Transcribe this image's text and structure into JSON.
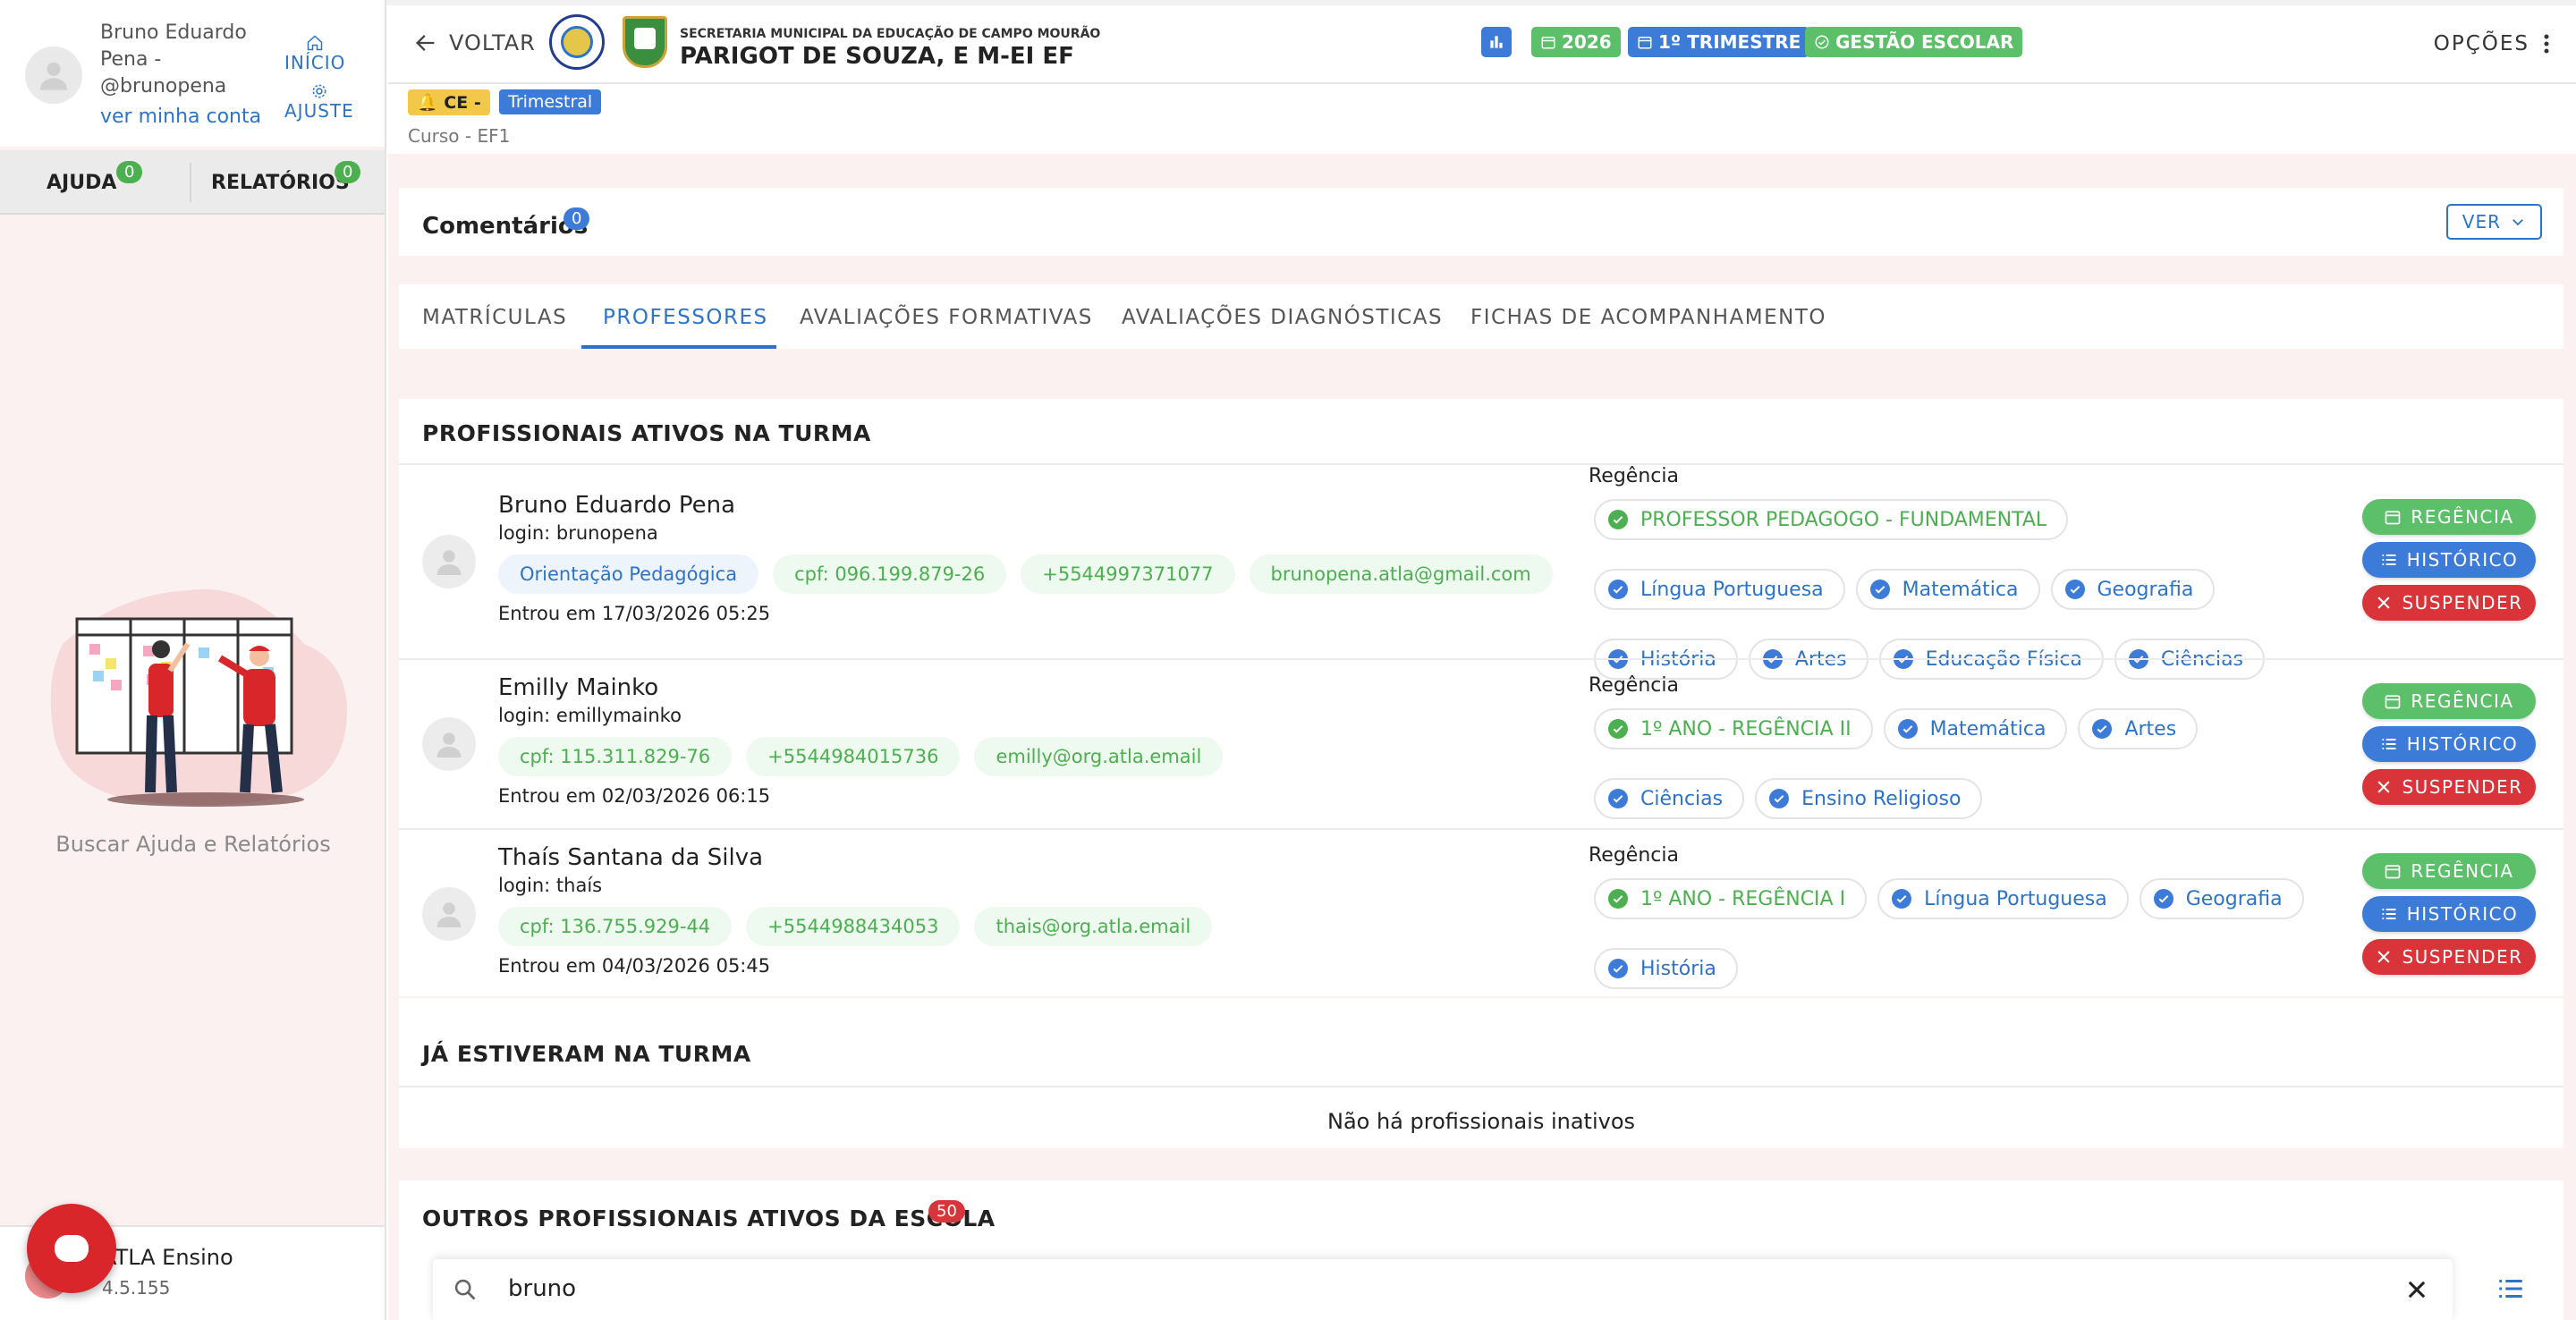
{
  "sidebar": {
    "user_name": "Bruno Eduardo Pena - @brunopena",
    "account_link": "ver minha conta",
    "nav_inicio": "INÍCIO",
    "nav_ajuste": "AJUSTE",
    "tab_ajuda": "AJUDA",
    "tab_ajuda_count": "0",
    "tab_relatorios": "RELATÓRIOS",
    "tab_relatorios_count": "0",
    "help_search": "Buscar Ajuda e Relatórios",
    "app_name": "ATLA Ensino",
    "app_version": "4.5.155"
  },
  "header": {
    "back": "VOLTAR",
    "secretaria": "SECRETARIA MUNICIPAL DA EDUCAÇÃO DE CAMPO MOURÃO",
    "school": "PARIGOT DE SOUZA, E M-EI EF",
    "chip_year": "2026",
    "chip_period": "1º TRIMESTRE",
    "chip_mode": "GESTÃO ESCOLAR",
    "options": "OPÇÕES"
  },
  "strip": {
    "tag_ce": "CE -",
    "tag_period": "Trimestral",
    "curso": "Curso - EF1"
  },
  "comments": {
    "title": "Comentários",
    "count": "0",
    "ver": "VER"
  },
  "tabs": [
    {
      "label": "MATRÍCULAS"
    },
    {
      "label": "PROFESSORES"
    },
    {
      "label": "AVALIAÇÕES FORMATIVAS"
    },
    {
      "label": "AVALIAÇÕES DIAGNÓSTICAS"
    },
    {
      "label": "FICHAS DE ACOMPANHAMENTO"
    }
  ],
  "active_section": {
    "title": "PROFISSIONAIS ATIVOS NA TURMA",
    "regencia_label": "Regência",
    "btn_regencia": "REGÊNCIA",
    "btn_historico": "HISTÓRICO",
    "btn_suspender": "SUSPENDER",
    "professionals": [
      {
        "name": "Bruno Eduardo Pena",
        "login": "login: brunopena",
        "role": "Orientação Pedagógica",
        "cpf": "cpf: 096.199.879-26",
        "phone": "+5544997371077",
        "email": "brunopena.atla@gmail.com",
        "entered": "Entrou em 17/03/2026 05:25",
        "regencias": [
          {
            "label": "PROFESSOR PEDAGOGO - FUNDAMENTAL",
            "kind": "g"
          },
          {
            "label": "Língua Portuguesa",
            "kind": "b"
          },
          {
            "label": "Matemática",
            "kind": "b"
          },
          {
            "label": "Geografia",
            "kind": "b"
          },
          {
            "label": "História",
            "kind": "b"
          },
          {
            "label": "Artes",
            "kind": "b"
          },
          {
            "label": "Educação Física",
            "kind": "b"
          },
          {
            "label": "Ciências",
            "kind": "b"
          }
        ]
      },
      {
        "name": "Emilly Mainko",
        "login": "login: emillymainko",
        "cpf": "cpf: 115.311.829-76",
        "phone": "+5544984015736",
        "email": "emilly@org.atla.email",
        "entered": "Entrou em 02/03/2026 06:15",
        "regencias": [
          {
            "label": "1º ANO - REGÊNCIA II",
            "kind": "g"
          },
          {
            "label": "Matemática",
            "kind": "b"
          },
          {
            "label": "Artes",
            "kind": "b"
          },
          {
            "label": "Ciências",
            "kind": "b"
          },
          {
            "label": "Ensino Religioso",
            "kind": "b"
          }
        ]
      },
      {
        "name": "Thaís Santana da Silva",
        "login": "login: thaís",
        "cpf": "cpf: 136.755.929-44",
        "phone": "+5544988434053",
        "email": "thais@org.atla.email",
        "entered": "Entrou em 04/03/2026 05:45",
        "regencias": [
          {
            "label": "1º ANO - REGÊNCIA I",
            "kind": "g"
          },
          {
            "label": "Língua Portuguesa",
            "kind": "b"
          },
          {
            "label": "Geografia",
            "kind": "b"
          },
          {
            "label": "História",
            "kind": "b"
          }
        ]
      }
    ]
  },
  "inactive_section": {
    "title": "JÁ ESTIVERAM NA TURMA",
    "empty": "Não há profissionais inativos"
  },
  "others_section": {
    "title": "OUTROS PROFISSIONAIS ATIVOS DA ESCOLA",
    "count": "50"
  },
  "search": {
    "value": "bruno"
  },
  "colors": {
    "accent_blue": "#2d73c7",
    "green": "#4caf50",
    "red": "#d9343a",
    "sidebar_bg": "#fcf1f1"
  }
}
